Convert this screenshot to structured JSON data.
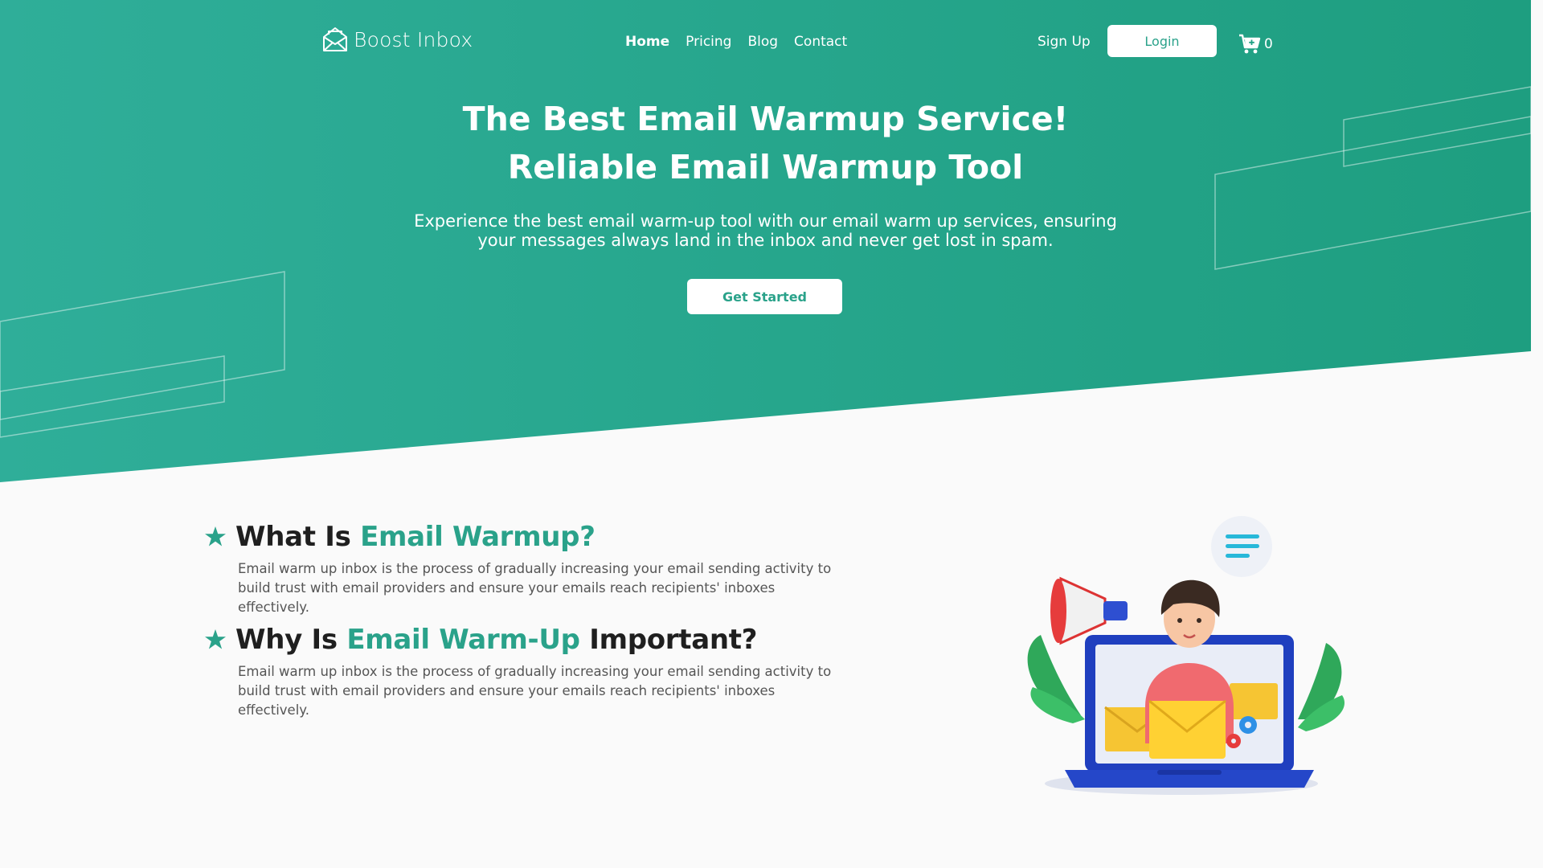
{
  "brand": {
    "name": "Boost Inbox",
    "logo_icon": "envelope-open-icon"
  },
  "nav": {
    "items": [
      {
        "label": "Home",
        "active": true
      },
      {
        "label": "Pricing",
        "active": false
      },
      {
        "label": "Blog",
        "active": false
      },
      {
        "label": "Contact",
        "active": false
      }
    ]
  },
  "auth": {
    "signup_label": "Sign Up",
    "login_label": "Login"
  },
  "cart": {
    "icon": "cart-plus-icon",
    "count": "0"
  },
  "hero": {
    "title_line1": "The Best Email Warmup Service!",
    "title_line2": "Reliable Email Warmup Tool",
    "subtitle": "Experience the best email warm-up tool with our email warm up services, ensuring your messages always land in the inbox and never get lost in spam.",
    "cta_label": "Get Started"
  },
  "sections": [
    {
      "icon": "star-icon",
      "title_prefix": "What Is ",
      "title_accent": "Email Warmup?",
      "title_suffix": "",
      "text": "Email warm up inbox is the process of gradually increasing your email sending activity to build trust with email providers and ensure your emails reach recipients' inboxes effectively."
    },
    {
      "icon": "star-icon",
      "title_prefix": "Why Is ",
      "title_accent": "Email Warm-Up",
      "title_suffix": " Important?",
      "text": "Email warm up inbox is the process of gradually increasing your email sending activity to build trust with email providers and ensure your emails reach recipients' inboxes effectively."
    }
  ],
  "illustration": {
    "icon": "woman-megaphone-laptop-illustration"
  },
  "colors": {
    "hero_gradient_start": "#2fae99",
    "hero_gradient_end": "#1e9e80",
    "accent": "#2aa28a",
    "background": "#fafafa"
  }
}
